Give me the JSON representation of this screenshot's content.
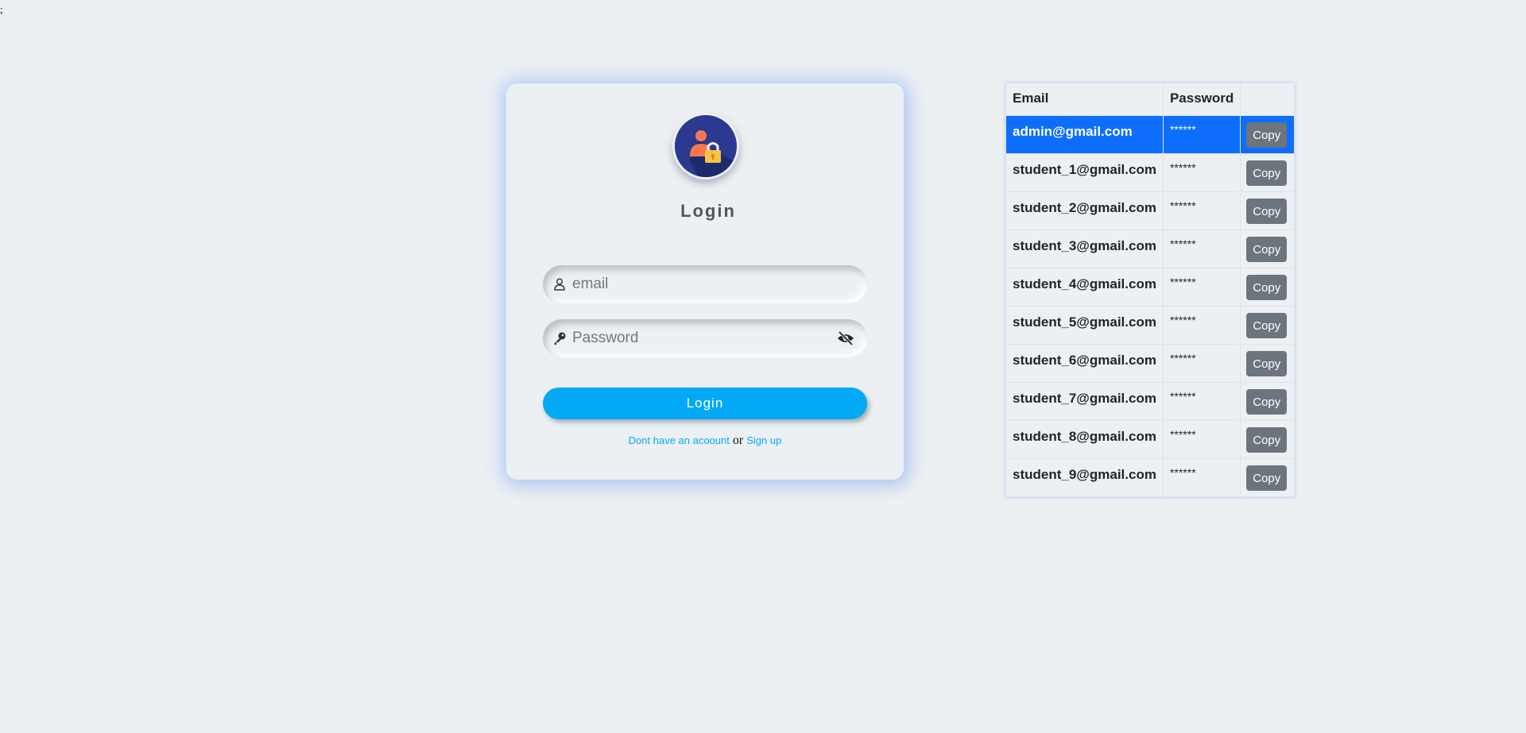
{
  "page": {
    "stray_text": ";"
  },
  "login": {
    "title": "Login",
    "email_placeholder": "email",
    "password_placeholder": "Password",
    "button_label": "Login",
    "no_account_text": "Dont have an acoount",
    "or_text": "or",
    "signup_text": "Sign up"
  },
  "table": {
    "headers": [
      "Email",
      "Password",
      ""
    ],
    "copy_label": "Copy",
    "rows": [
      {
        "email": "admin@gmail.com",
        "password": "******",
        "active": true
      },
      {
        "email": "student_1@gmail.com",
        "password": "******",
        "active": false
      },
      {
        "email": "student_2@gmail.com",
        "password": "******",
        "active": false
      },
      {
        "email": "student_3@gmail.com",
        "password": "******",
        "active": false
      },
      {
        "email": "student_4@gmail.com",
        "password": "******",
        "active": false
      },
      {
        "email": "student_5@gmail.com",
        "password": "******",
        "active": false
      },
      {
        "email": "student_6@gmail.com",
        "password": "******",
        "active": false
      },
      {
        "email": "student_7@gmail.com",
        "password": "******",
        "active": false
      },
      {
        "email": "student_8@gmail.com",
        "password": "******",
        "active": false
      },
      {
        "email": "student_9@gmail.com",
        "password": "******",
        "active": false
      }
    ]
  },
  "colors": {
    "background": "#ecf0f3",
    "accent": "#03a9f4",
    "active_row": "#0d6efd",
    "copy_button": "#6c757d"
  }
}
